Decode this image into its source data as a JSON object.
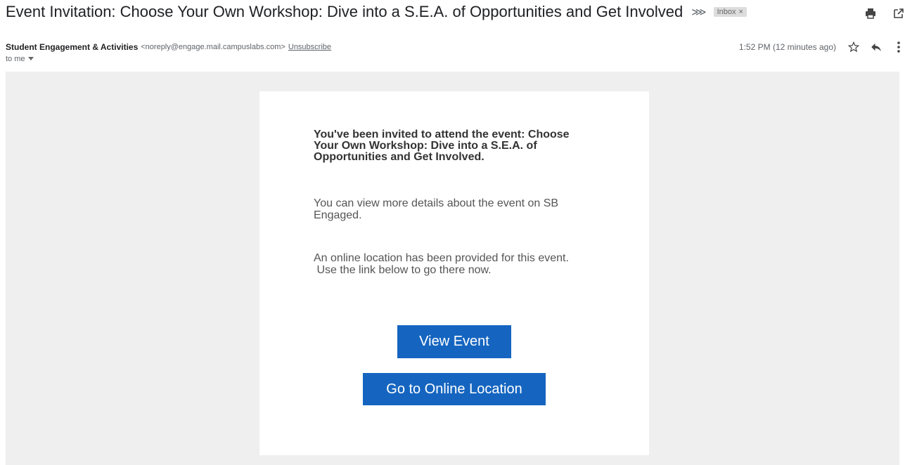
{
  "subject": "Event Invitation: Choose Your Own Workshop: Dive into a S.E.A. of Opportunities and Get Involved",
  "label": "Inbox",
  "label_close": "×",
  "sender": {
    "name": "Student Engagement & Activities",
    "email": "<noreply@engage.mail.campuslabs.com>",
    "unsubscribe": "Unsubscribe"
  },
  "time": "1:52 PM (12 minutes ago)",
  "recipient": "to me",
  "body": {
    "heading": "You've been invited to attend the event: Choose Your Own Workshop: Dive into a S.E.A. of Opportunities and Get Involved.",
    "details": "You can view more details about the event on SB Engaged.",
    "location_note": "An online location has been provided for this event.\n Use the link below to go there now.",
    "view_event_label": "View Event",
    "online_location_label": "Go to Online Location"
  },
  "colors": {
    "button": "#1565c0",
    "canvas": "#efefef"
  },
  "icons": [
    "important-icon",
    "print-icon",
    "open-in-new-icon",
    "star-icon",
    "reply-icon",
    "more-vert-icon",
    "caret-down-icon"
  ]
}
